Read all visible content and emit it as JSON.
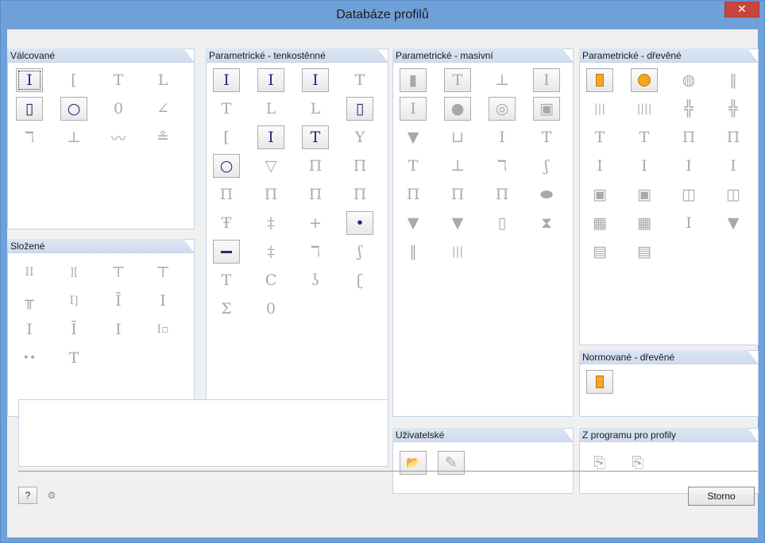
{
  "window": {
    "title": "Databáze profilů",
    "close_glyph": "✕"
  },
  "groups": {
    "valcovane": {
      "label": "Válcované",
      "cells": [
        {
          "g": "I",
          "icon": "i-section-icon",
          "en": true,
          "dk": true,
          "sel": true
        },
        {
          "g": "[",
          "icon": "channel-section-icon"
        },
        {
          "g": "T",
          "icon": "t-section-icon"
        },
        {
          "g": "L",
          "icon": "angle-section-icon"
        },
        {
          "g": "▯",
          "icon": "rect-hollow-section-icon",
          "en": true,
          "dk": true
        },
        {
          "g": "○",
          "icon": "circle-hollow-section-icon",
          "en": true,
          "dk": true
        },
        {
          "g": "0",
          "icon": "oval-section-icon"
        },
        {
          "g": "∠",
          "icon": "unequal-angle-icon"
        },
        {
          "g": "ℸ",
          "icon": "z-section-icon"
        },
        {
          "g": "⊥",
          "icon": "rail-section-icon"
        },
        {
          "g": "〰",
          "icon": "sheet-pile-icon"
        },
        {
          "g": "≗",
          "icon": "crane-rail-icon"
        }
      ]
    },
    "slozene": {
      "label": "Složené",
      "cells": [
        {
          "g": "II",
          "icon": "double-i-icon"
        },
        {
          "g": "][",
          "icon": "double-channel-icon"
        },
        {
          "g": "⊤",
          "icon": "t-plate-icon"
        },
        {
          "g": "⊤",
          "icon": "double-angle-icon"
        },
        {
          "g": "╥",
          "icon": "double-t-icon"
        },
        {
          "g": "I]",
          "icon": "i-channel-icon"
        },
        {
          "g": "Ī",
          "icon": "i-plate-icon"
        },
        {
          "g": "I",
          "icon": "i-cover-icon"
        },
        {
          "g": "I",
          "icon": "i-stiffened-icon"
        },
        {
          "g": "Ī",
          "icon": "i-t-icon"
        },
        {
          "g": "I",
          "icon": "small-i-icon"
        },
        {
          "g": "I▫",
          "icon": "i-tube-icon"
        },
        {
          "g": "••",
          "icon": "two-bars-icon"
        },
        {
          "g": "T",
          "icon": "t-stem-icon"
        }
      ]
    },
    "tenkostenne": {
      "label": "Parametrické - tenkostěnné",
      "cells": [
        {
          "g": "I",
          "icon": "param-i-icon",
          "en": true,
          "dk": true
        },
        {
          "g": "I",
          "icon": "param-i-unsym-icon",
          "en": true,
          "dk": true
        },
        {
          "g": "I",
          "icon": "param-i-tapered-icon",
          "en": true,
          "dk": true
        },
        {
          "g": "T",
          "icon": "param-t-icon"
        },
        {
          "g": "T",
          "icon": "param-t-thin-icon"
        },
        {
          "g": "L",
          "icon": "param-l-icon"
        },
        {
          "g": "L",
          "icon": "param-l-unequal-icon"
        },
        {
          "g": "▯",
          "icon": "param-box-icon",
          "en": true,
          "dk": true
        },
        {
          "g": "[",
          "icon": "param-channel-icon"
        },
        {
          "g": "I",
          "icon": "param-i-welded-icon",
          "en": true,
          "dk": true
        },
        {
          "g": "T",
          "icon": "param-t-welded-icon",
          "en": true,
          "dk": true
        },
        {
          "g": "Y",
          "icon": "param-y-icon"
        },
        {
          "g": "○",
          "icon": "param-tube-icon",
          "en": true,
          "dk": true
        },
        {
          "g": "▽",
          "icon": "param-triangle-icon"
        },
        {
          "g": "Π",
          "icon": "param-pi-icon"
        },
        {
          "g": "Π",
          "icon": "param-pi-flange-icon"
        },
        {
          "g": "Π",
          "icon": "param-pi-double-icon"
        },
        {
          "g": "Π",
          "icon": "param-pi-triple-icon"
        },
        {
          "g": "Π",
          "icon": "param-pi-open-icon"
        },
        {
          "g": "Π",
          "icon": "param-pi-lip-icon"
        },
        {
          "g": "Ŧ",
          "icon": "param-i-rib-icon"
        },
        {
          "g": "‡",
          "icon": "param-i-rib2-icon"
        },
        {
          "g": "+",
          "icon": "param-cross-icon"
        },
        {
          "g": "•",
          "icon": "param-dot-icon",
          "en": true,
          "dk": true
        },
        {
          "g": "bar",
          "icon": "param-flat-bar-icon",
          "en": true,
          "dk": true
        },
        {
          "g": "‡",
          "icon": "param-i-stud-icon"
        },
        {
          "g": "ℸ",
          "icon": "param-z-icon"
        },
        {
          "g": "ʃ",
          "icon": "param-s-icon"
        },
        {
          "g": "T",
          "icon": "param-t-lip-icon"
        },
        {
          "g": "C",
          "icon": "param-c-lip-icon"
        },
        {
          "g": "ʖ",
          "icon": "param-sigma-lip-icon"
        },
        {
          "g": "ʗ",
          "icon": "param-c-return-icon"
        },
        {
          "g": "Σ",
          "icon": "param-sigma-icon"
        },
        {
          "g": "0",
          "icon": "param-oval-icon"
        }
      ]
    },
    "masivni": {
      "label": "Parametrické - masivní",
      "cells": [
        {
          "g": "▮",
          "icon": "solid-rect-icon",
          "en": true
        },
        {
          "g": "T",
          "icon": "solid-t-icon",
          "en": true
        },
        {
          "g": "⊥",
          "icon": "solid-inv-t-icon"
        },
        {
          "g": "I",
          "icon": "solid-i-icon",
          "en": true
        },
        {
          "g": "I",
          "icon": "solid-i-wide-icon",
          "en": true
        },
        {
          "g": "●",
          "icon": "solid-circle-icon",
          "en": true
        },
        {
          "g": "◎",
          "icon": "solid-ring-icon",
          "en": true
        },
        {
          "g": "▣",
          "icon": "solid-box-icon",
          "en": true
        },
        {
          "g": "▼",
          "icon": "solid-trapezoid-icon"
        },
        {
          "g": "⊔",
          "icon": "solid-u-icon"
        },
        {
          "g": "I",
          "icon": "solid-i-taper-icon"
        },
        {
          "g": "T",
          "icon": "solid-t-taper-icon"
        },
        {
          "g": "T",
          "icon": "solid-t-step-icon"
        },
        {
          "g": "⊥",
          "icon": "solid-l-step-icon"
        },
        {
          "g": "ℸ",
          "icon": "solid-z-icon"
        },
        {
          "g": "ʃ",
          "icon": "solid-s-icon"
        },
        {
          "g": "Π",
          "icon": "solid-pi-icon"
        },
        {
          "g": "Π",
          "icon": "solid-pi-wide-icon"
        },
        {
          "g": "Π",
          "icon": "solid-pi-taper-icon"
        },
        {
          "g": "⬬",
          "icon": "solid-oval-icon"
        },
        {
          "g": "▼",
          "icon": "solid-t-beam-icon"
        },
        {
          "g": "▼",
          "icon": "solid-t-beam2-icon"
        },
        {
          "g": "▯",
          "icon": "solid-hollow-icon"
        },
        {
          "g": "⧗",
          "icon": "solid-hourglass-icon"
        },
        {
          "g": "‖",
          "icon": "solid-two-rect-icon"
        },
        {
          "g": "|||",
          "icon": "solid-three-rect-icon"
        }
      ]
    },
    "drevene": {
      "label": "Parametrické - dřevěné",
      "cells": [
        {
          "g": "rect",
          "icon": "timber-rect-icon",
          "en": true
        },
        {
          "g": "circle",
          "icon": "timber-circle-icon",
          "en": true
        },
        {
          "g": "◍",
          "icon": "timber-round-icon"
        },
        {
          "g": "‖",
          "icon": "timber-two-icon"
        },
        {
          "g": "|||",
          "icon": "timber-three-icon"
        },
        {
          "g": "||||",
          "icon": "timber-four-icon"
        },
        {
          "g": "╬",
          "icon": "timber-cross-icon"
        },
        {
          "g": "╬",
          "icon": "timber-cross2-icon"
        },
        {
          "g": "T",
          "icon": "timber-t-icon"
        },
        {
          "g": "T",
          "icon": "timber-t2-icon"
        },
        {
          "g": "Π",
          "icon": "timber-pi-icon"
        },
        {
          "g": "Π",
          "icon": "timber-pi2-icon"
        },
        {
          "g": "I",
          "icon": "timber-i-icon"
        },
        {
          "g": "I",
          "icon": "timber-i2-icon"
        },
        {
          "g": "I",
          "icon": "timber-i3-icon"
        },
        {
          "g": "I",
          "icon": "timber-i4-icon"
        },
        {
          "g": "▣",
          "icon": "timber-box-icon"
        },
        {
          "g": "▣",
          "icon": "timber-box2-icon"
        },
        {
          "g": "◫",
          "icon": "timber-box3-icon"
        },
        {
          "g": "◫",
          "icon": "timber-box4-icon"
        },
        {
          "g": "▦",
          "icon": "timber-grid-icon"
        },
        {
          "g": "▦",
          "icon": "timber-grid2-icon"
        },
        {
          "g": "I",
          "icon": "timber-i5-icon"
        },
        {
          "g": "▼",
          "icon": "timber-taper-icon"
        },
        {
          "g": "▤",
          "icon": "timber-lam-icon"
        },
        {
          "g": "▤",
          "icon": "timber-lam2-icon"
        }
      ]
    },
    "normovane": {
      "label": "Normované - dřevěné",
      "cells": [
        {
          "g": "rect",
          "icon": "norm-timber-rect-icon",
          "en": true
        }
      ]
    },
    "uzivatelske": {
      "label": "Uživatelské",
      "cells": [
        {
          "g": "📂",
          "icon": "open-folder-icon",
          "en": true
        },
        {
          "g": "✎",
          "icon": "edit-note-icon",
          "en": true
        }
      ]
    },
    "program": {
      "label": "Z programu pro profily",
      "cells": [
        {
          "g": "⎘",
          "icon": "import-profile-icon"
        },
        {
          "g": "⎘",
          "icon": "import-section-icon"
        }
      ]
    }
  },
  "footer": {
    "storno_label": "Storno",
    "help_glyph": "?",
    "units_glyph": "⚙"
  },
  "colors": {
    "titlebar": "#6fa0d8",
    "close": "#c7453c",
    "accent_dark": "#1e2a78",
    "timber": "#f5a623"
  }
}
